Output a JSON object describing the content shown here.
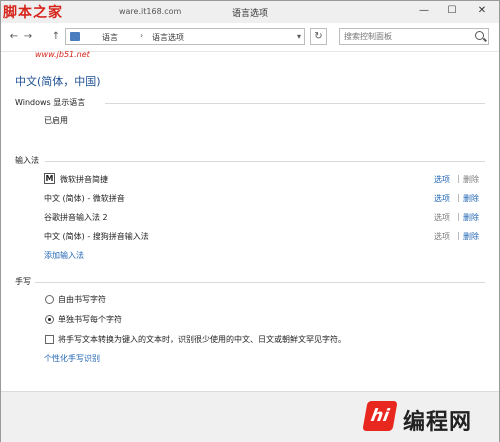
{
  "window": {
    "title": "语言选项",
    "minimize": "—",
    "maximize": "☐",
    "close": "✕"
  },
  "watermark": {
    "site_name": "脚本之家",
    "url_fragment": "ware.it168.com",
    "url": "www.jb51.net"
  },
  "addressbar": {
    "back": "←",
    "forward": "→",
    "up": "↑",
    "crumbs": [
      "语言",
      "语言选项"
    ],
    "separator": "›",
    "dropdown": "▾",
    "refresh": "↻",
    "search_placeholder": "搜索控制面板"
  },
  "page": {
    "title": "中文(简体，中国)"
  },
  "display_language": {
    "header": "Windows 显示语言",
    "status": "已启用"
  },
  "input_methods": {
    "header": "输入法",
    "m_icon": "M",
    "items": [
      {
        "label": "微软拼音简捷",
        "option": "选项",
        "remove": "删除"
      },
      {
        "label": "中文 (简体) - 微软拼音",
        "option": "选项",
        "remove": "删除"
      },
      {
        "label": "谷歌拼音输入法 2",
        "option": "选项",
        "remove": "删除"
      },
      {
        "label": "中文 (简体) - 搜狗拼音输入法",
        "option": "选项",
        "remove": "删除"
      }
    ],
    "add_link": "添加输入法"
  },
  "handwriting": {
    "header": "手写",
    "option_free": "自由书写字符",
    "option_single": "单独书写每个字符",
    "checkbox_label": "将手写文本转换为键入的文本时，识别很少使用的中文、日文或朝鲜文罕见字符。",
    "personalize_link": "个性化手写识别"
  },
  "footer_logo": {
    "mark": "hi",
    "text": "编程网"
  }
}
